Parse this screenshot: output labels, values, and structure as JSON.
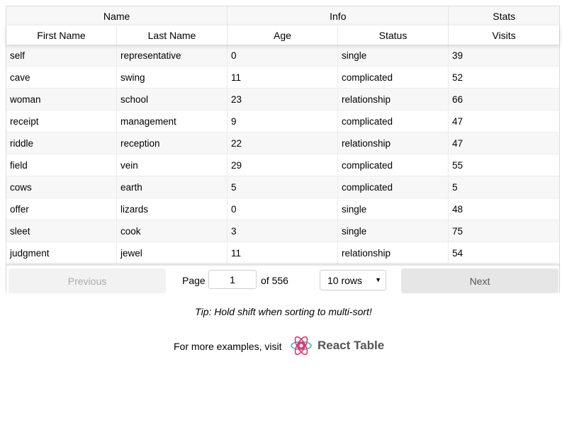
{
  "table": {
    "groups": {
      "name": "Name",
      "info": "Info",
      "stats": "Stats"
    },
    "columns": [
      "First Name",
      "Last Name",
      "Age",
      "Status",
      "Visits"
    ],
    "rows": [
      [
        "self",
        "representative",
        "0",
        "single",
        "39"
      ],
      [
        "cave",
        "swing",
        "11",
        "complicated",
        "52"
      ],
      [
        "woman",
        "school",
        "23",
        "relationship",
        "66"
      ],
      [
        "receipt",
        "management",
        "9",
        "complicated",
        "47"
      ],
      [
        "riddle",
        "reception",
        "22",
        "relationship",
        "47"
      ],
      [
        "field",
        "vein",
        "29",
        "complicated",
        "55"
      ],
      [
        "cows",
        "earth",
        "5",
        "complicated",
        "5"
      ],
      [
        "offer",
        "lizards",
        "0",
        "single",
        "48"
      ],
      [
        "sleet",
        "cook",
        "3",
        "single",
        "75"
      ],
      [
        "judgment",
        "jewel",
        "11",
        "relationship",
        "54"
      ]
    ]
  },
  "pagination": {
    "previous_label": "Previous",
    "next_label": "Next",
    "page_label": "Page",
    "page_value": "1",
    "of_label": "of 556",
    "rows_selected": "10 rows"
  },
  "tip": "Tip: Hold shift when sorting to multi-sort!",
  "more_examples": "For more examples, visit",
  "logo_text": "React Table",
  "colors": {
    "logo_pink": "#e8336d",
    "logo_teal": "#3ab8c8"
  }
}
